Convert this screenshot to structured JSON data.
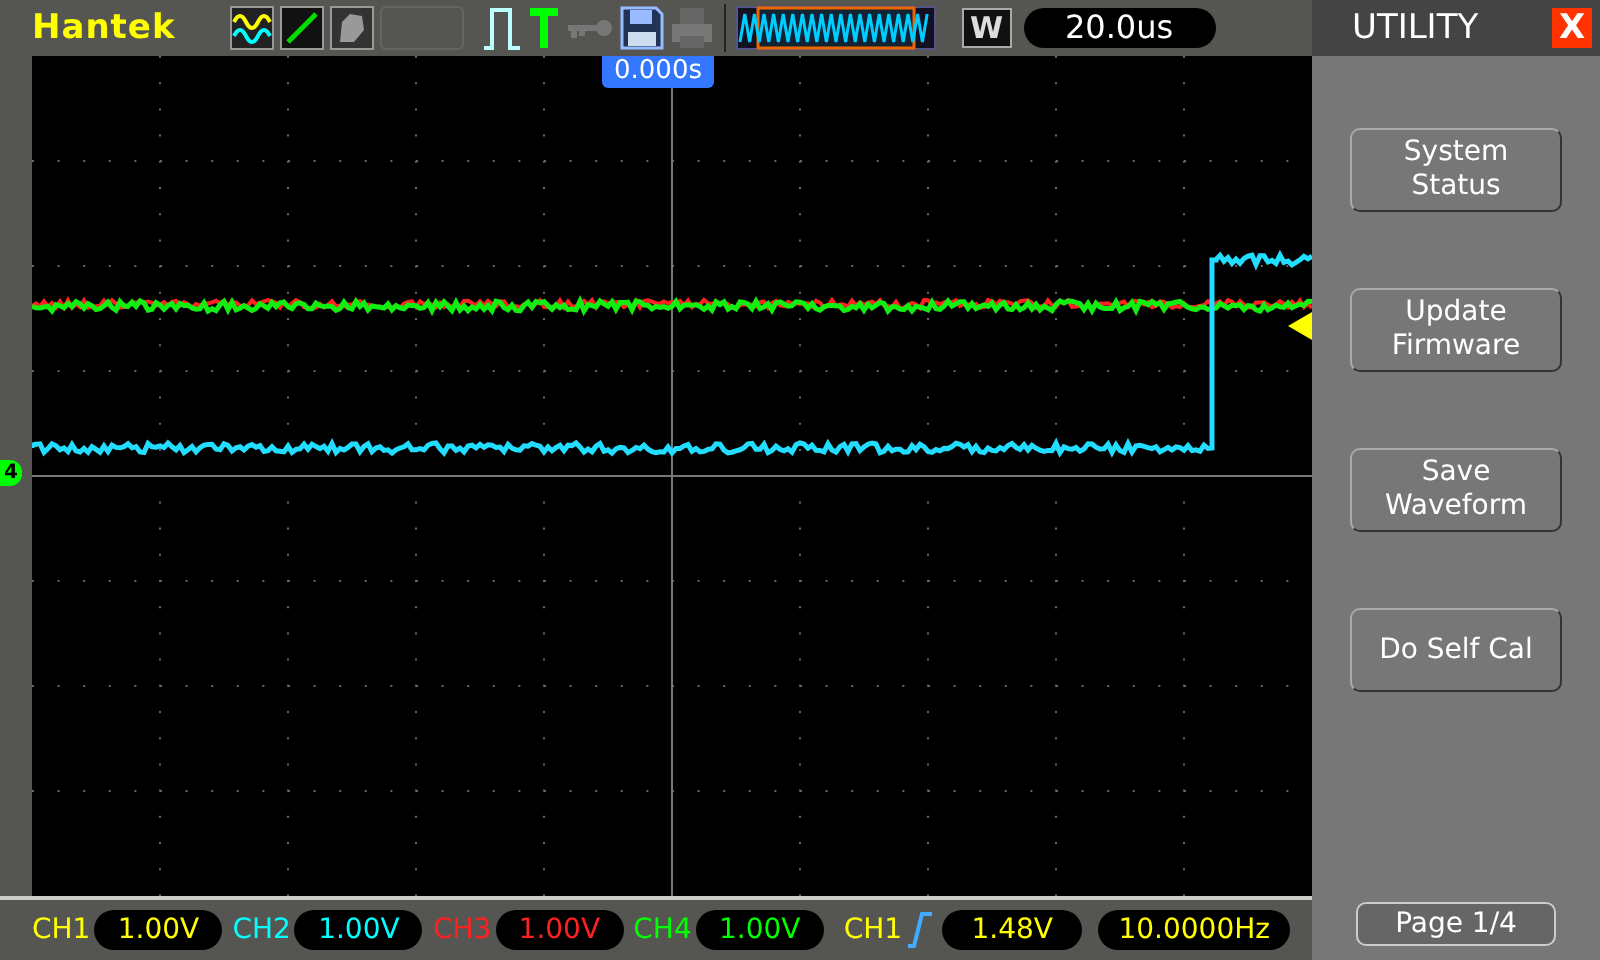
{
  "header": {
    "brand": "Hantek",
    "window_mode": "W",
    "timebase": "20.0us"
  },
  "trigger_position": "0.000s",
  "ground_marker": "4",
  "menu": {
    "title": "UTILITY",
    "close": "X",
    "buttons": [
      {
        "lines": [
          "System",
          "Status"
        ]
      },
      {
        "lines": [
          "Update",
          "Firmware"
        ]
      },
      {
        "lines": [
          "Save",
          "Waveform"
        ]
      },
      {
        "lines": [
          "Do Self Cal"
        ]
      }
    ],
    "page": "Page 1/4"
  },
  "channels": [
    {
      "name": "CH1",
      "scale": "1.00V",
      "color": "#ffff00"
    },
    {
      "name": "CH2",
      "scale": "1.00V",
      "color": "#00ffff"
    },
    {
      "name": "CH3",
      "scale": "1.00V",
      "color": "#ff2020"
    },
    {
      "name": "CH4",
      "scale": "1.00V",
      "color": "#00ff00"
    }
  ],
  "trigger": {
    "source": "CH1",
    "reading": "1.48V",
    "frequency": "10.0000Hz"
  }
}
